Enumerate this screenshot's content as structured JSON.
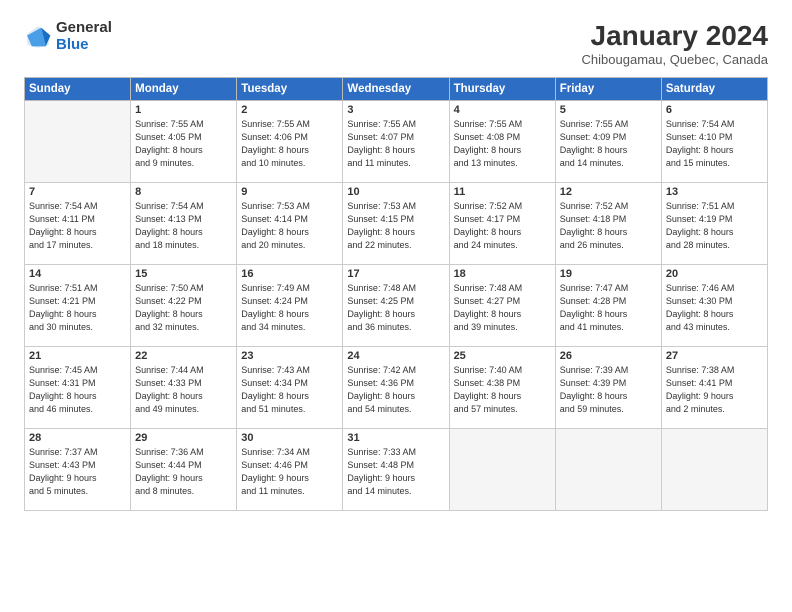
{
  "header": {
    "logo_general": "General",
    "logo_blue": "Blue",
    "month_title": "January 2024",
    "subtitle": "Chibougamau, Quebec, Canada"
  },
  "weekdays": [
    "Sunday",
    "Monday",
    "Tuesday",
    "Wednesday",
    "Thursday",
    "Friday",
    "Saturday"
  ],
  "weeks": [
    [
      {
        "day": "",
        "info": ""
      },
      {
        "day": "1",
        "info": "Sunrise: 7:55 AM\nSunset: 4:05 PM\nDaylight: 8 hours\nand 9 minutes."
      },
      {
        "day": "2",
        "info": "Sunrise: 7:55 AM\nSunset: 4:06 PM\nDaylight: 8 hours\nand 10 minutes."
      },
      {
        "day": "3",
        "info": "Sunrise: 7:55 AM\nSunset: 4:07 PM\nDaylight: 8 hours\nand 11 minutes."
      },
      {
        "day": "4",
        "info": "Sunrise: 7:55 AM\nSunset: 4:08 PM\nDaylight: 8 hours\nand 13 minutes."
      },
      {
        "day": "5",
        "info": "Sunrise: 7:55 AM\nSunset: 4:09 PM\nDaylight: 8 hours\nand 14 minutes."
      },
      {
        "day": "6",
        "info": "Sunrise: 7:54 AM\nSunset: 4:10 PM\nDaylight: 8 hours\nand 15 minutes."
      }
    ],
    [
      {
        "day": "7",
        "info": "Sunrise: 7:54 AM\nSunset: 4:11 PM\nDaylight: 8 hours\nand 17 minutes."
      },
      {
        "day": "8",
        "info": "Sunrise: 7:54 AM\nSunset: 4:13 PM\nDaylight: 8 hours\nand 18 minutes."
      },
      {
        "day": "9",
        "info": "Sunrise: 7:53 AM\nSunset: 4:14 PM\nDaylight: 8 hours\nand 20 minutes."
      },
      {
        "day": "10",
        "info": "Sunrise: 7:53 AM\nSunset: 4:15 PM\nDaylight: 8 hours\nand 22 minutes."
      },
      {
        "day": "11",
        "info": "Sunrise: 7:52 AM\nSunset: 4:17 PM\nDaylight: 8 hours\nand 24 minutes."
      },
      {
        "day": "12",
        "info": "Sunrise: 7:52 AM\nSunset: 4:18 PM\nDaylight: 8 hours\nand 26 minutes."
      },
      {
        "day": "13",
        "info": "Sunrise: 7:51 AM\nSunset: 4:19 PM\nDaylight: 8 hours\nand 28 minutes."
      }
    ],
    [
      {
        "day": "14",
        "info": "Sunrise: 7:51 AM\nSunset: 4:21 PM\nDaylight: 8 hours\nand 30 minutes."
      },
      {
        "day": "15",
        "info": "Sunrise: 7:50 AM\nSunset: 4:22 PM\nDaylight: 8 hours\nand 32 minutes."
      },
      {
        "day": "16",
        "info": "Sunrise: 7:49 AM\nSunset: 4:24 PM\nDaylight: 8 hours\nand 34 minutes."
      },
      {
        "day": "17",
        "info": "Sunrise: 7:48 AM\nSunset: 4:25 PM\nDaylight: 8 hours\nand 36 minutes."
      },
      {
        "day": "18",
        "info": "Sunrise: 7:48 AM\nSunset: 4:27 PM\nDaylight: 8 hours\nand 39 minutes."
      },
      {
        "day": "19",
        "info": "Sunrise: 7:47 AM\nSunset: 4:28 PM\nDaylight: 8 hours\nand 41 minutes."
      },
      {
        "day": "20",
        "info": "Sunrise: 7:46 AM\nSunset: 4:30 PM\nDaylight: 8 hours\nand 43 minutes."
      }
    ],
    [
      {
        "day": "21",
        "info": "Sunrise: 7:45 AM\nSunset: 4:31 PM\nDaylight: 8 hours\nand 46 minutes."
      },
      {
        "day": "22",
        "info": "Sunrise: 7:44 AM\nSunset: 4:33 PM\nDaylight: 8 hours\nand 49 minutes."
      },
      {
        "day": "23",
        "info": "Sunrise: 7:43 AM\nSunset: 4:34 PM\nDaylight: 8 hours\nand 51 minutes."
      },
      {
        "day": "24",
        "info": "Sunrise: 7:42 AM\nSunset: 4:36 PM\nDaylight: 8 hours\nand 54 minutes."
      },
      {
        "day": "25",
        "info": "Sunrise: 7:40 AM\nSunset: 4:38 PM\nDaylight: 8 hours\nand 57 minutes."
      },
      {
        "day": "26",
        "info": "Sunrise: 7:39 AM\nSunset: 4:39 PM\nDaylight: 8 hours\nand 59 minutes."
      },
      {
        "day": "27",
        "info": "Sunrise: 7:38 AM\nSunset: 4:41 PM\nDaylight: 9 hours\nand 2 minutes."
      }
    ],
    [
      {
        "day": "28",
        "info": "Sunrise: 7:37 AM\nSunset: 4:43 PM\nDaylight: 9 hours\nand 5 minutes."
      },
      {
        "day": "29",
        "info": "Sunrise: 7:36 AM\nSunset: 4:44 PM\nDaylight: 9 hours\nand 8 minutes."
      },
      {
        "day": "30",
        "info": "Sunrise: 7:34 AM\nSunset: 4:46 PM\nDaylight: 9 hours\nand 11 minutes."
      },
      {
        "day": "31",
        "info": "Sunrise: 7:33 AM\nSunset: 4:48 PM\nDaylight: 9 hours\nand 14 minutes."
      },
      {
        "day": "",
        "info": ""
      },
      {
        "day": "",
        "info": ""
      },
      {
        "day": "",
        "info": ""
      }
    ]
  ]
}
